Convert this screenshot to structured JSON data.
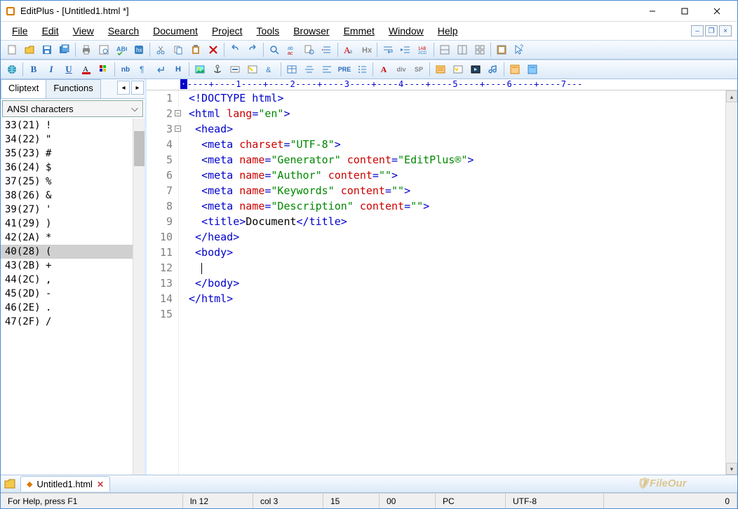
{
  "window": {
    "title": "EditPlus - [Untitled1.html *]"
  },
  "menu": {
    "file": "File",
    "edit": "Edit",
    "view": "View",
    "search": "Search",
    "document": "Document",
    "project": "Project",
    "tools": "Tools",
    "browser": "Browser",
    "emmet": "Emmet",
    "window_m": "Window",
    "help": "Help"
  },
  "sidepanel": {
    "tab_cliptext": "Cliptext",
    "tab_functions": "Functions",
    "dropdown": "ANSI characters",
    "chars": [
      {
        "code": "33(21)",
        "ch": "!",
        "sel": false
      },
      {
        "code": "34(22)",
        "ch": "\"",
        "sel": false
      },
      {
        "code": "35(23)",
        "ch": "#",
        "sel": false
      },
      {
        "code": "36(24)",
        "ch": "$",
        "sel": false
      },
      {
        "code": "37(25)",
        "ch": "%",
        "sel": false
      },
      {
        "code": "38(26)",
        "ch": "&",
        "sel": false
      },
      {
        "code": "39(27)",
        "ch": "'",
        "sel": false
      },
      {
        "code": "41(29)",
        "ch": ")",
        "sel": false
      },
      {
        "code": "42(2A)",
        "ch": "*",
        "sel": false
      },
      {
        "code": "40(28)",
        "ch": "(",
        "sel": true
      },
      {
        "code": "43(2B)",
        "ch": "+",
        "sel": false
      },
      {
        "code": "44(2C)",
        "ch": ",",
        "sel": false
      },
      {
        "code": "45(2D)",
        "ch": "-",
        "sel": false
      },
      {
        "code": "46(2E)",
        "ch": ".",
        "sel": false
      },
      {
        "code": "47(2F)",
        "ch": "/",
        "sel": false
      }
    ]
  },
  "ruler": "----+----1----+----2----+----3----+----4----+----5----+----6----+----7---",
  "code_lines": [
    {
      "n": 1,
      "html": "<span class='t-tag'>&lt;!DOCTYPE html&gt;</span>"
    },
    {
      "n": 2,
      "fold": true,
      "html": "<span class='t-tag'>&lt;html</span> <span class='t-attr'>lang</span><span class='t-tag'>=</span><span class='t-val'>\"en\"</span><span class='t-tag'>&gt;</span>"
    },
    {
      "n": 3,
      "fold": true,
      "html": " <span class='t-tag'>&lt;head&gt;</span>"
    },
    {
      "n": 4,
      "html": "  <span class='t-tag'>&lt;meta</span> <span class='t-attr'>charset</span><span class='t-tag'>=</span><span class='t-val'>\"UTF-8\"</span><span class='t-tag'>&gt;</span>"
    },
    {
      "n": 5,
      "html": "  <span class='t-tag'>&lt;meta</span> <span class='t-attr'>name</span><span class='t-tag'>=</span><span class='t-val'>\"Generator\"</span> <span class='t-attr'>content</span><span class='t-tag'>=</span><span class='t-val'>\"EditPlus®\"</span><span class='t-tag'>&gt;</span>"
    },
    {
      "n": 6,
      "html": "  <span class='t-tag'>&lt;meta</span> <span class='t-attr'>name</span><span class='t-tag'>=</span><span class='t-val'>\"Author\"</span> <span class='t-attr'>content</span><span class='t-tag'>=</span><span class='t-val'>\"\"</span><span class='t-tag'>&gt;</span>"
    },
    {
      "n": 7,
      "html": "  <span class='t-tag'>&lt;meta</span> <span class='t-attr'>name</span><span class='t-tag'>=</span><span class='t-val'>\"Keywords\"</span> <span class='t-attr'>content</span><span class='t-tag'>=</span><span class='t-val'>\"\"</span><span class='t-tag'>&gt;</span>"
    },
    {
      "n": 8,
      "html": "  <span class='t-tag'>&lt;meta</span> <span class='t-attr'>name</span><span class='t-tag'>=</span><span class='t-val'>\"Description\"</span> <span class='t-attr'>content</span><span class='t-tag'>=</span><span class='t-val'>\"\"</span><span class='t-tag'>&gt;</span>"
    },
    {
      "n": 9,
      "html": "  <span class='t-tag'>&lt;title&gt;</span><span class='t-text'>Document</span><span class='t-tag'>&lt;/title&gt;</span>"
    },
    {
      "n": 10,
      "html": " <span class='t-tag'>&lt;/head&gt;</span>"
    },
    {
      "n": 11,
      "html": " <span class='t-tag'>&lt;body&gt;</span>"
    },
    {
      "n": 12,
      "arrow": true,
      "html": "  <span class='cursor-line'></span>"
    },
    {
      "n": 13,
      "html": " <span class='t-tag'>&lt;/body&gt;</span>"
    },
    {
      "n": 14,
      "html": "<span class='t-tag'>&lt;/html&gt;</span>"
    },
    {
      "n": 15,
      "html": ""
    }
  ],
  "doctab": {
    "label": "Untitled1.html"
  },
  "status": {
    "help": "For Help, press F1",
    "ln": "ln 12",
    "col": "col 3",
    "sel": "15",
    "zero": "00",
    "mode": "PC",
    "enc": "UTF-8",
    "tail": "0"
  },
  "toolbar2_text": {
    "nb": "nb",
    "h": "H",
    "pre": "PRE",
    "a": "A",
    "div": "div",
    "sp": "SP",
    "b": "B",
    "i": "I",
    "u": "U"
  }
}
